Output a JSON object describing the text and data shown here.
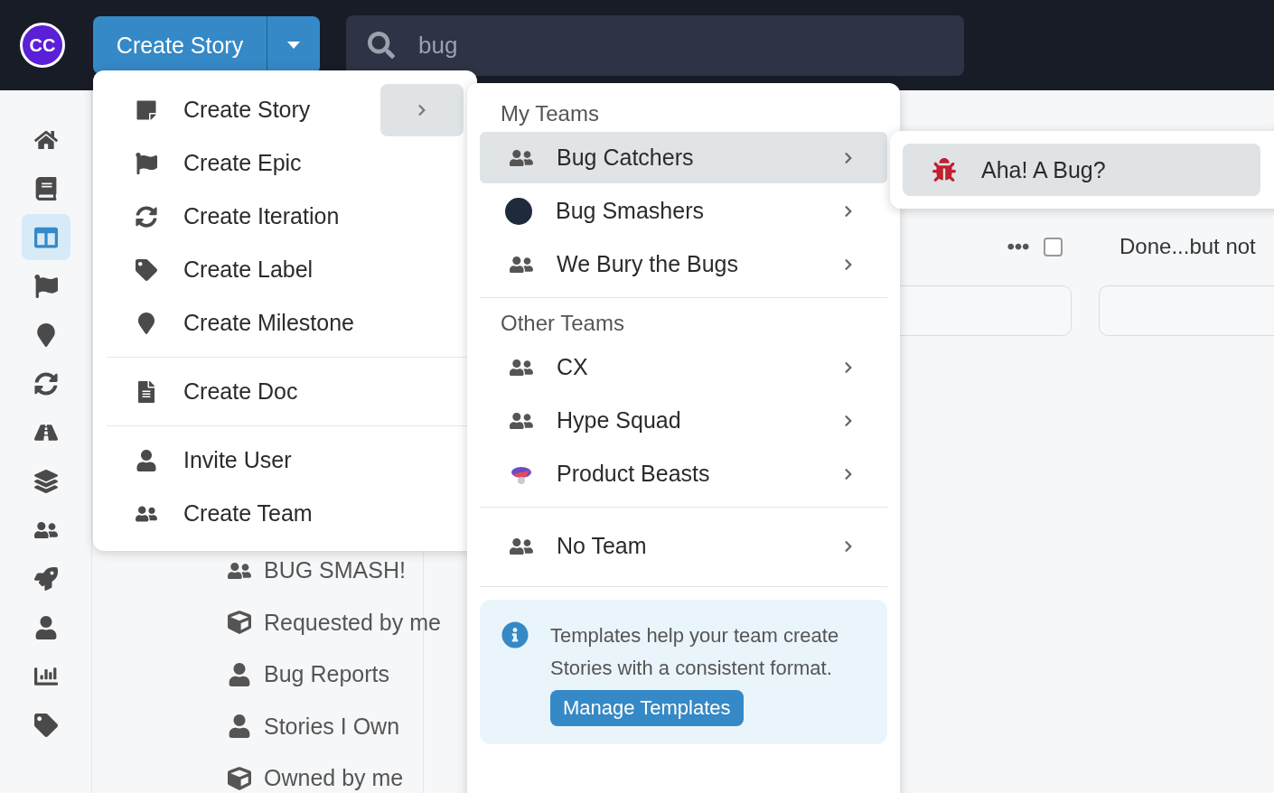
{
  "topbar": {
    "logo_text": "CC",
    "create_button": {
      "label": "Create Story"
    },
    "search": {
      "value": "bug"
    }
  },
  "rail": [
    {
      "kind": "home",
      "selected": false
    },
    {
      "kind": "book",
      "selected": false
    },
    {
      "kind": "board",
      "selected": true
    },
    {
      "kind": "flag",
      "selected": false
    },
    {
      "kind": "pin",
      "selected": false
    },
    {
      "kind": "cycle",
      "selected": false
    },
    {
      "kind": "road",
      "selected": false
    },
    {
      "kind": "stack",
      "selected": false
    },
    {
      "kind": "team",
      "selected": false
    },
    {
      "kind": "rocket",
      "selected": false
    },
    {
      "kind": "person",
      "selected": false
    },
    {
      "kind": "chart",
      "selected": false
    },
    {
      "kind": "tag",
      "selected": false
    }
  ],
  "sidebar": {
    "items": [
      {
        "kind": "team",
        "label": "BUG SMASH!"
      },
      {
        "kind": "box",
        "label": "Requested by me"
      },
      {
        "kind": "person",
        "label": "Bug Reports"
      },
      {
        "kind": "person",
        "label": "Stories I Own"
      },
      {
        "kind": "box",
        "label": "Owned by me"
      }
    ]
  },
  "board": {
    "column_title": "Done...but not",
    "checked": false
  },
  "create_menu": {
    "sections": [
      [
        {
          "kind": "story",
          "label": "Create Story",
          "expanded": true
        },
        {
          "kind": "flag",
          "label": "Create Epic",
          "expanded": false
        },
        {
          "kind": "cycle",
          "label": "Create Iteration",
          "expanded": false
        },
        {
          "kind": "tag",
          "label": "Create Label",
          "expanded": false
        },
        {
          "kind": "pin",
          "label": "Create Milestone",
          "expanded": false
        }
      ],
      [
        {
          "kind": "doc",
          "label": "Create Doc",
          "expanded": false
        }
      ],
      [
        {
          "kind": "person",
          "label": "Invite User",
          "expanded": false
        },
        {
          "kind": "team",
          "label": "Create Team",
          "expanded": false
        }
      ]
    ]
  },
  "teams_menu": {
    "groups": [
      {
        "title": "My Teams",
        "teams": [
          {
            "name": "Bug Catchers",
            "kind": "group",
            "selected": true
          },
          {
            "name": "Bug Smashers",
            "kind": "photo",
            "selected": false
          },
          {
            "name": "We Bury the Bugs",
            "kind": "group",
            "selected": false
          }
        ]
      },
      {
        "title": "Other Teams",
        "teams": [
          {
            "name": "CX",
            "kind": "group",
            "selected": false
          },
          {
            "name": "Hype Squad",
            "kind": "group",
            "selected": false
          },
          {
            "name": "Product Beasts",
            "kind": "logo",
            "selected": false
          }
        ]
      }
    ],
    "no_team": {
      "name": "No Team",
      "kind": "group",
      "selected": false
    },
    "info": {
      "text": "Templates help your team create Stories with a consistent format.",
      "button": "Manage Templates"
    }
  },
  "templates_menu": {
    "items": [
      {
        "label": "Aha! A Bug?",
        "selected": true
      }
    ]
  }
}
